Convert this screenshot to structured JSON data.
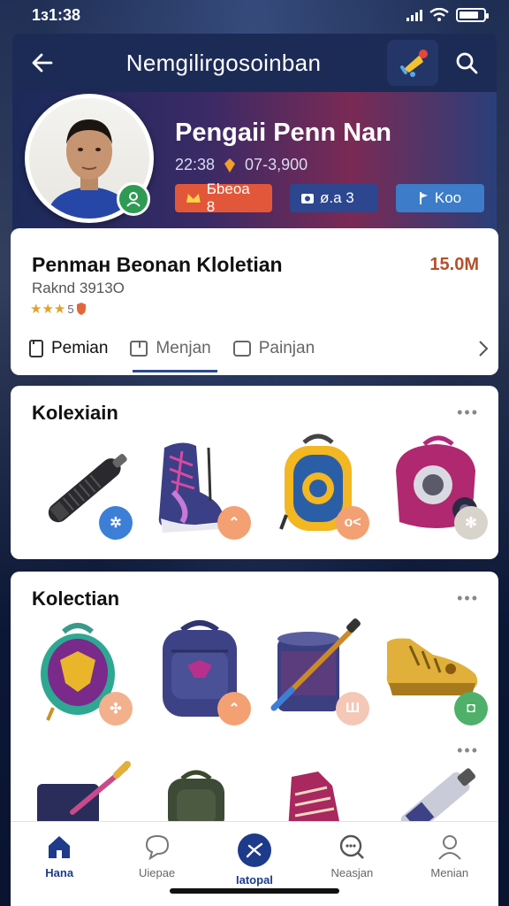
{
  "status_bar": {
    "time": "1з1:38"
  },
  "app_bar": {
    "title": "Nemgilirgosoinban",
    "back_icon": "arrow-left-icon",
    "notification_icon": "bell-icon",
    "search_icon": "search-icon"
  },
  "profile": {
    "name": "Pengaii Penn Nan",
    "stat_a": "22:38",
    "stat_b": "07-3,900",
    "badges": [
      {
        "label": "Бbeoa 8",
        "color": "#e2573a",
        "icon": "crown-icon"
      },
      {
        "label": "ø.a 3",
        "color": "#2c4790",
        "icon": "camera-icon"
      },
      {
        "label": "Koo",
        "color": "#3c7cc8",
        "icon": "flag-icon"
      }
    ]
  },
  "info_card": {
    "title": "Penmaн Beonan Kloletian",
    "value": "15.0M",
    "rank": "Raknd 3913O",
    "stars_text": "5",
    "rating_fraction": 0.8,
    "tabs": [
      {
        "label": "Pemian",
        "active": true
      },
      {
        "label": "Menjan",
        "active": false
      },
      {
        "label": "Painjan",
        "active": false
      }
    ]
  },
  "collections": [
    {
      "title": "Kolexiain",
      "more": "•••",
      "items": [
        {
          "name": "black-bat",
          "badge": "✲",
          "badge_color": "#3d7fd6"
        },
        {
          "name": "sneaker",
          "badge": "⌃",
          "badge_color": "#f3a073"
        },
        {
          "name": "yellow-backpack",
          "badge": "o<",
          "badge_color": "#f3a073"
        },
        {
          "name": "pink-bag",
          "badge": "✻",
          "badge_color": "#d8d4cc"
        }
      ]
    },
    {
      "title": "Kolectian",
      "more": "•••",
      "items": [
        {
          "name": "purple-shield-bag",
          "badge": "✣",
          "badge_color": "#f3b08c"
        },
        {
          "name": "navy-backpack",
          "badge": "⌃",
          "badge_color": "#f3a073"
        },
        {
          "name": "bat-bucket",
          "badge": "Ш",
          "badge_color": "#f4c7b7"
        },
        {
          "name": "gold-shoe",
          "badge": "◘",
          "badge_color": "#4fb06a"
        }
      ]
    }
  ],
  "bottom_nav": [
    {
      "label": "Hana",
      "icon": "home-icon",
      "active": true
    },
    {
      "label": "Uiepae",
      "icon": "chat-icon",
      "active": false
    },
    {
      "label": "Iatopal",
      "icon": "compass-icon",
      "active": true
    },
    {
      "label": "Neasjan",
      "icon": "search-chat-icon",
      "active": false
    },
    {
      "label": "Menian",
      "icon": "person-icon",
      "active": false
    }
  ]
}
